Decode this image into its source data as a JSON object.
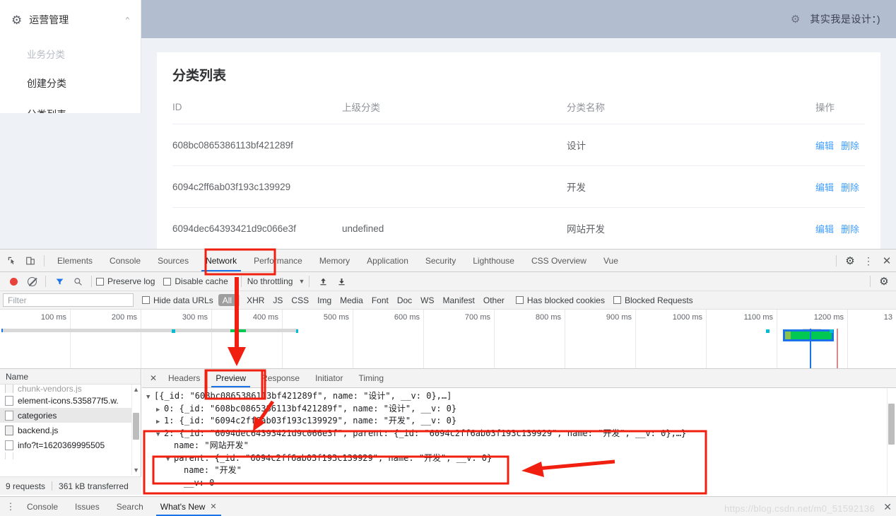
{
  "webapp": {
    "sidebar": {
      "header": {
        "icon": "gear-icon",
        "title": "运营管理",
        "chevron": "chevron-up-icon"
      },
      "items": [
        {
          "label": "业务分类",
          "muted": true
        },
        {
          "label": "创建分类",
          "muted": false
        },
        {
          "label": "分类列表",
          "muted": false
        }
      ]
    },
    "header": {
      "icon": "gear-icon",
      "text": "其实我是设计：)"
    },
    "main": {
      "title": "分类列表",
      "table": {
        "columns": [
          "ID",
          "上级分类",
          "分类名称",
          "操作"
        ],
        "rows": [
          {
            "id": "608bc0865386113bf421289f",
            "parent": "",
            "name": "设计",
            "edit": "编辑",
            "delete": "删除"
          },
          {
            "id": "6094c2ff6ab03f193c139929",
            "parent": "",
            "name": "开发",
            "edit": "编辑",
            "delete": "删除"
          },
          {
            "id": "6094dec64393421d9c066e3f",
            "parent": "undefined",
            "name": "网站开发",
            "edit": "编辑",
            "delete": "删除"
          }
        ]
      }
    }
  },
  "devtools": {
    "tabs": [
      "Elements",
      "Console",
      "Sources",
      "Network",
      "Performance",
      "Memory",
      "Application",
      "Security",
      "Lighthouse",
      "CSS Overview",
      "Vue"
    ],
    "active_tab": "Network",
    "left_icons": [
      "inspect-icon",
      "device-toolbar-icon"
    ],
    "right_icons": [
      "gear-icon",
      "kebab-menu-icon",
      "close-icon"
    ],
    "toolbar": {
      "record_button": "record-icon",
      "clear_button": "clear-icon",
      "filter_button": "filter-icon",
      "search_button": "search-icon",
      "preserve_log": "Preserve log",
      "disable_cache": "Disable cache",
      "throttling": "No throttling",
      "import_icon": "import-har-icon",
      "export_icon": "export-har-icon",
      "settings_icon": "gear-icon"
    },
    "filterbar": {
      "filter_placeholder": "Filter",
      "hide_data_urls": "Hide data URLs",
      "types": [
        "All",
        "XHR",
        "JS",
        "CSS",
        "Img",
        "Media",
        "Font",
        "Doc",
        "WS",
        "Manifest",
        "Other"
      ],
      "selected_type": "All",
      "has_blocked_cookies": "Has blocked cookies",
      "blocked_requests": "Blocked Requests"
    },
    "timeline": {
      "ticks": [
        "100 ms",
        "200 ms",
        "300 ms",
        "400 ms",
        "500 ms",
        "600 ms",
        "700 ms",
        "800 ms",
        "900 ms",
        "1000 ms",
        "1100 ms",
        "1200 ms",
        "13"
      ]
    },
    "requests": {
      "column_header": "Name",
      "items": [
        {
          "name": "chunk-vendors.js",
          "icon": "js-file-icon",
          "selected": false,
          "clipped": true
        },
        {
          "name": "element-icons.535877f5.w.",
          "icon": "file-icon",
          "selected": false
        },
        {
          "name": "categories",
          "icon": "file-icon",
          "selected": true
        },
        {
          "name": "backend.js",
          "icon": "js-file-icon",
          "selected": false
        },
        {
          "name": "info?t=1620369995505",
          "icon": "file-icon",
          "selected": false
        }
      ],
      "summary": {
        "requests": "9 requests",
        "transferred": "361 kB transferred"
      }
    },
    "detail": {
      "close_icon": "close-icon",
      "tabs": [
        "Headers",
        "Preview",
        "Response",
        "Initiator",
        "Timing"
      ],
      "active_tab": "Preview",
      "preview_lines": [
        {
          "indent": 0,
          "twisty": "▼",
          "text": "[{_id: \"608bc0865386113bf421289f\", name: \"设计\", __v: 0},…]"
        },
        {
          "indent": 1,
          "twisty": "▶",
          "text": "0: {_id: \"608bc0865386113bf421289f\", name: \"设计\", __v: 0}"
        },
        {
          "indent": 1,
          "twisty": "▶",
          "text": "1: {_id: \"6094c2ff6ab03f193c139929\", name: \"开发\", __v: 0}"
        },
        {
          "indent": 1,
          "twisty": "▼",
          "text": "2: {_id: \"6094dec64393421d9c066e3f\", parent: {_id: \"6094c2ff6ab03f193c139929\", name: \"开发\", __v: 0},…}"
        },
        {
          "indent": 2,
          "twisty": "",
          "text": "name: \"网站开发\""
        },
        {
          "indent": 2,
          "twisty": "▼",
          "text": "parent: {_id: \"6094c2ff6ab03f193c139929\", name: \"开发\", __v: 0}"
        },
        {
          "indent": 3,
          "twisty": "",
          "text": "name: \"开发\""
        },
        {
          "indent": 3,
          "twisty": "",
          "text": "__v: 0"
        }
      ]
    },
    "drawer": {
      "kebab": "kebab-menu-icon",
      "tabs": [
        "Console",
        "Issues",
        "Search",
        "What's New"
      ],
      "active_tab": "What's New",
      "close_icon": "close-icon"
    }
  },
  "watermark": {
    "text": "https://blog.csdn.net/m0_51592136"
  },
  "annotations": {
    "accent_color": "#f01f0f",
    "boxes": [
      "network-tab-box",
      "timeline-region-box",
      "preview-tab-box",
      "json-item2-box",
      "json-parent-box"
    ],
    "arrows": [
      "arrow-down-to-timeline",
      "arrow-to-json-line2",
      "arrow-left-to-parent"
    ]
  }
}
